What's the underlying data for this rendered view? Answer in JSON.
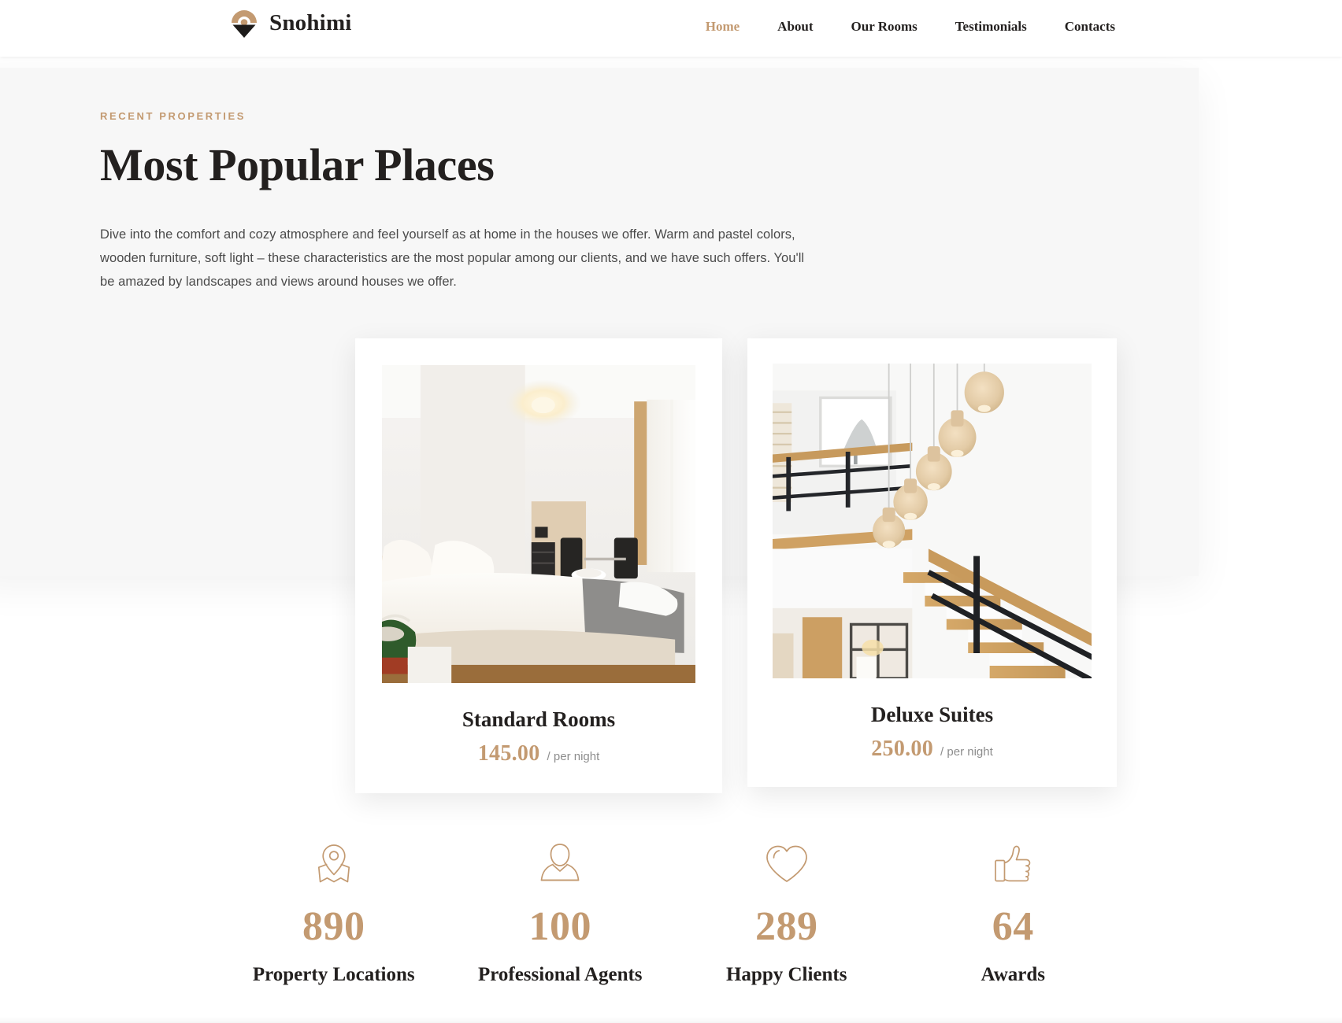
{
  "brand": {
    "name": "Snohimi",
    "logo_icon": "pin-logo-icon",
    "logo_colors": {
      "arc": "#c39a71",
      "chevron": "#1d1b1a"
    }
  },
  "nav": {
    "items": [
      {
        "label": "Home",
        "active": true
      },
      {
        "label": "About",
        "active": false
      },
      {
        "label": "Our Rooms",
        "active": false
      },
      {
        "label": "Testimonials",
        "active": false
      },
      {
        "label": "Contacts",
        "active": false
      }
    ]
  },
  "section": {
    "eyebrow": "RECENT PROPERTIES",
    "title": "Most Popular Places",
    "body": "Dive into the comfort and cozy atmosphere and feel yourself as at home in the houses we offer. Warm and pastel colors, wooden furniture, soft light – these characteristics are the most popular among our clients, and we have such offers. You'll be amazed by landscapes and views around houses we offer."
  },
  "cards": [
    {
      "title": "Standard Rooms",
      "price": "145.00",
      "period": "/ per night",
      "photo_alt": "bright hotel bedroom with white bed, pillows, grey throw and rolled towels"
    },
    {
      "title": "Deluxe Suites",
      "price": "250.00",
      "period": "/ per night",
      "photo_alt": "modern staircase with wooden treads, black railing and hanging bulb pendant lights"
    }
  ],
  "stats": [
    {
      "icon": "map-pin-icon",
      "value": "890",
      "label": "Property Locations"
    },
    {
      "icon": "agent-person-icon",
      "value": "100",
      "label": "Professional Agents"
    },
    {
      "icon": "heart-icon",
      "value": "289",
      "label": "Happy Clients"
    },
    {
      "icon": "thumbs-up-icon",
      "value": "64",
      "label": "Awards"
    }
  ],
  "colors": {
    "accent": "#c39a71",
    "ink": "#23201f",
    "body_text": "#4a4a4a",
    "muted": "#8d8d8d",
    "panel_bg": "#f7f7f7",
    "page_bg": "#ffffff"
  }
}
